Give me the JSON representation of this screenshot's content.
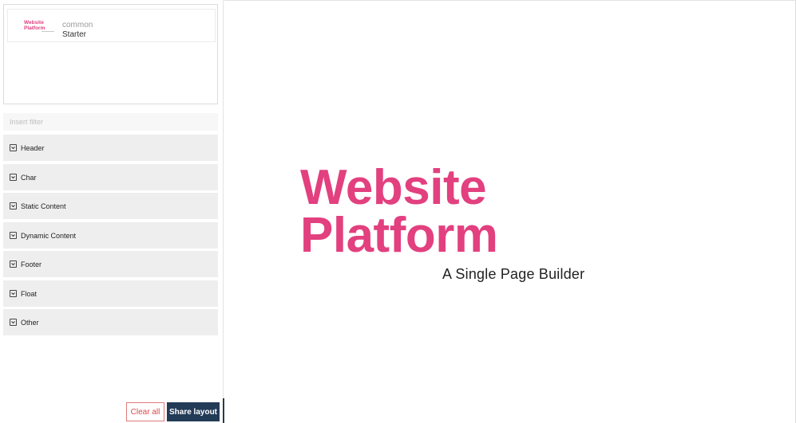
{
  "template": {
    "logo_line1": "Website",
    "logo_line2": "Platform",
    "group": "common",
    "name": "Starter"
  },
  "filter": {
    "placeholder": "Insert filter",
    "value": ""
  },
  "categories": [
    {
      "label": "Header"
    },
    {
      "label": "Char"
    },
    {
      "label": "Static Content"
    },
    {
      "label": "Dynamic Content"
    },
    {
      "label": "Footer"
    },
    {
      "label": "Float"
    },
    {
      "label": "Other"
    }
  ],
  "actions": {
    "clear_label": "Clear all",
    "share_label": "Share layout",
    "collapse_icon": "chevron-left-icon"
  },
  "canvas": {
    "title_line1": "Website",
    "title_line2": "Platform",
    "subtitle": "A Single Page Builder"
  },
  "colors": {
    "brand": "#e2407f",
    "share_button": "#223b57",
    "clear_border": "#e07a7a"
  }
}
